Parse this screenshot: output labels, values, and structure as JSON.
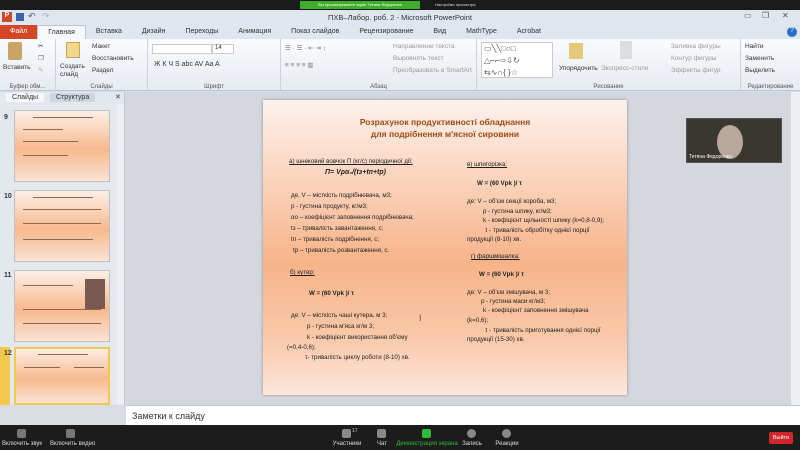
{
  "zoom": {
    "share_banner": "Вы просматриваете экран Тетяна Федоренко",
    "view_options": "Настройки просмотра",
    "participant_count": "17",
    "toolbar": [
      {
        "label": "Включить звук",
        "icon": "microphone-muted-icon"
      },
      {
        "label": "Включить видео",
        "icon": "video-off-icon"
      },
      {
        "label": "Участники",
        "icon": "participants-icon"
      },
      {
        "label": "Чат",
        "icon": "chat-icon"
      },
      {
        "label": "Демонстрация экрана",
        "icon": "share-screen-icon"
      },
      {
        "label": "Запись",
        "icon": "record-icon"
      },
      {
        "label": "Реакции",
        "icon": "reactions-icon"
      }
    ],
    "leave_label": "Выйти",
    "video_name": "Тетяна Федоренко"
  },
  "ppt": {
    "title": "ПХВ–Лабор. роб. 2 - Microsoft PowerPoint",
    "tabs": [
      "Файл",
      "Главная",
      "Вставка",
      "Дизайн",
      "Переходы",
      "Анимация",
      "Показ слайдов",
      "Рецензирование",
      "Вид",
      "MathType",
      "Acrobat"
    ],
    "ribbon": {
      "clipboard": {
        "paste": "Вставить",
        "label": "Буфер обм..."
      },
      "slides": {
        "create": "Создать слайд",
        "layout": "Макет",
        "reset": "Восстановить",
        "section": "Раздел",
        "label": "Слайды"
      },
      "font": {
        "size": "14",
        "label": "Шрифт"
      },
      "paragraph": {
        "direction": "Направление текста",
        "align": "Выровнять текст",
        "smartart": "Преобразовать в SmartArt",
        "label": "Абзац"
      },
      "drawing": {
        "arrange": "Упорядочить",
        "styles": "Экспресс-стили",
        "fill": "Заливка фигуры",
        "outline": "Контур фигуры",
        "effects": "Эффекты фигур",
        "label": "Рисование"
      },
      "editing": {
        "find": "Найти",
        "replace": "Заменить",
        "select": "Выделить",
        "label": "Редактирование"
      }
    },
    "panel_tabs": [
      "Слайды",
      "Структура"
    ],
    "thumbnails": [
      "9",
      "10",
      "11",
      "12"
    ],
    "notes_placeholder": "Заметки к слайду"
  },
  "slide": {
    "title": [
      "Розрахунок продуктивності обладнання",
      "для подрібнення м'ясної сировини"
    ],
    "a": {
      "heading": "а)  шнековий  вовчок П (кг/с) періодичної дії:",
      "formula": "П=  Vρα₀/(tз+tп+tр)",
      "lines": [
        "де,  V – місткість подрібнювача, м3;",
        "p - густина продукту, кг/м3;",
        "αо – коефіцієнт заповнення подрібнювача;",
        "tз – тривалість завантаження, с;",
        "tп – тривалість подрібнення, с;",
        "tр – тривалість розвантаження, с."
      ]
    },
    "b": {
      "heading": "б) кутер:",
      "formula": "W = (60 Vpk )/ τ",
      "lines": [
        "де:     V – місткість чаші кутера, м 3;",
        "p -  густина м'яса кг/м 3;",
        "k -  коефіцієнт використання об'єму",
        "(=0,4-0,6);",
        "τ- тривалість циклу роботи     (8-10) хв."
      ]
    },
    "c": {
      "heading": "в) шпигорізка:",
      "formula": "W = (60 Vpk )/ τ",
      "lines": [
        "де:      V – об'єм секції короба, м3;",
        "p  -  густина шпику, кг/м3;",
        "k  -  коефіцієнт щільності шпику     (k=0,8-0,9);",
        "τ - тривалість обробітку однієї порції",
        "продукції  (8-10) хв."
      ]
    },
    "d": {
      "heading": "г) фаршмішалка:",
      "formula": "W = (60 Vpk )/ τ",
      "lines": [
        "де:      V – об'єм  змішувача, м 3;",
        "p  -  густина маси кг/м3;",
        "k  -  коефіцієнт заповнення змішувача",
        "(k=0,6);",
        "τ  - тривалість приготування однієї порції",
        "продукції  (15-30) хв."
      ]
    }
  }
}
